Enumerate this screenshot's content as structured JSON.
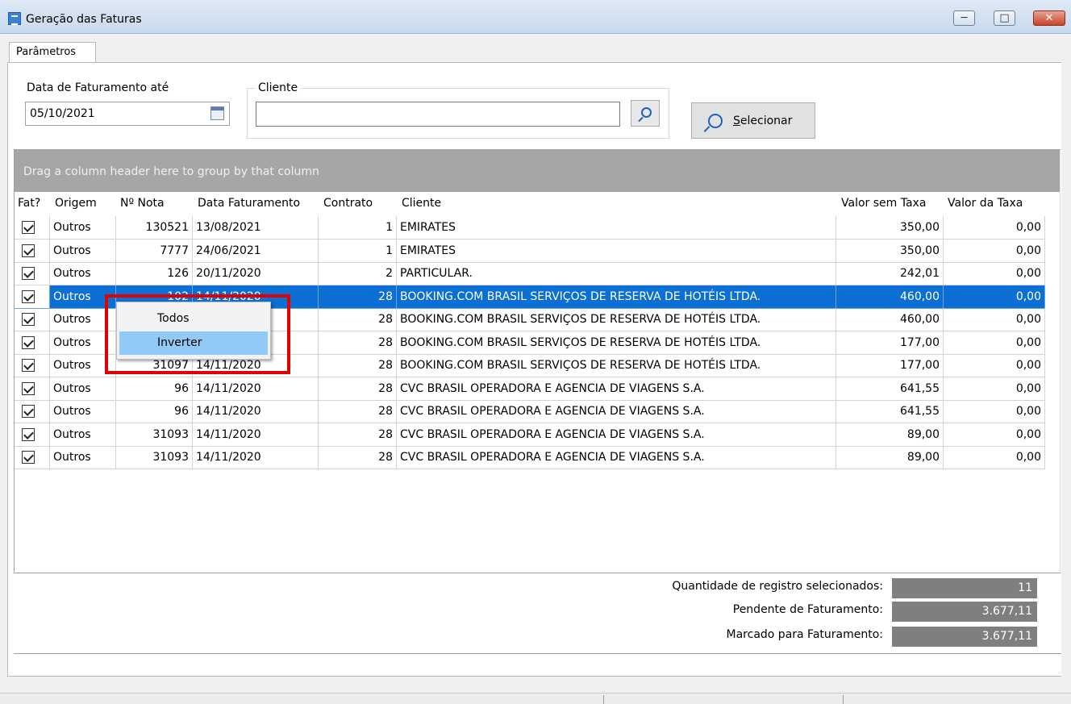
{
  "window": {
    "title": "Geração das Faturas",
    "min_glyph": "─",
    "max_glyph": "□",
    "close_glyph": "✕"
  },
  "tab": {
    "label": "Parâmetros"
  },
  "form": {
    "date_label": "Data de Faturamento até",
    "date_value": "05/10/2021",
    "client_legend": "Cliente",
    "client_value": "",
    "select_button_mnemonic": "S",
    "select_button_rest": "elecionar"
  },
  "grid": {
    "group_hint": "Drag a column header here to group by that column",
    "columns": [
      "Fat?",
      "Origem",
      "Nº Nota",
      "Data Faturamento",
      "Contrato",
      "Cliente",
      "Valor sem Taxa",
      "Valor da Taxa"
    ],
    "rows": [
      {
        "origem": "Outros",
        "nota": "130521",
        "data": "13/08/2021",
        "contrato": "1",
        "cliente": "EMIRATES",
        "valor": "350,00",
        "taxa": "0,00"
      },
      {
        "origem": "Outros",
        "nota": "7777",
        "data": "24/06/2021",
        "contrato": "1",
        "cliente": "EMIRATES",
        "valor": "350,00",
        "taxa": "0,00"
      },
      {
        "origem": "Outros",
        "nota": "126",
        "data": "20/11/2020",
        "contrato": "2",
        "cliente": "PARTICULAR.",
        "valor": "242,01",
        "taxa": "0,00"
      },
      {
        "origem": "Outros",
        "nota": "102",
        "data": "14/11/2020",
        "contrato": "28",
        "cliente": "BOOKING.COM BRASIL SERVIÇOS DE RESERVA DE HOTÉIS LTDA.",
        "valor": "460,00",
        "taxa": "0,00"
      },
      {
        "origem": "Outros",
        "nota": "",
        "data": "",
        "contrato": "28",
        "cliente": "BOOKING.COM BRASIL SERVIÇOS DE RESERVA DE HOTÉIS LTDA.",
        "valor": "460,00",
        "taxa": "0,00"
      },
      {
        "origem": "Outros",
        "nota": "",
        "data": "",
        "contrato": "28",
        "cliente": "BOOKING.COM BRASIL SERVIÇOS DE RESERVA DE HOTÉIS LTDA.",
        "valor": "177,00",
        "taxa": "0,00"
      },
      {
        "origem": "Outros",
        "nota": "31097",
        "data": "14/11/2020",
        "contrato": "28",
        "cliente": "BOOKING.COM BRASIL SERVIÇOS DE RESERVA DE HOTÉIS LTDA.",
        "valor": "177,00",
        "taxa": "0,00"
      },
      {
        "origem": "Outros",
        "nota": "96",
        "data": "14/11/2020",
        "contrato": "28",
        "cliente": "CVC BRASIL OPERADORA E AGENCIA DE VIAGENS S.A.",
        "valor": "641,55",
        "taxa": "0,00"
      },
      {
        "origem": "Outros",
        "nota": "96",
        "data": "14/11/2020",
        "contrato": "28",
        "cliente": "CVC BRASIL OPERADORA E AGENCIA DE VIAGENS S.A.",
        "valor": "641,55",
        "taxa": "0,00"
      },
      {
        "origem": "Outros",
        "nota": "31093",
        "data": "14/11/2020",
        "contrato": "28",
        "cliente": "CVC BRASIL OPERADORA E AGENCIA DE VIAGENS S.A.",
        "valor": "89,00",
        "taxa": "0,00"
      },
      {
        "origem": "Outros",
        "nota": "31093",
        "data": "14/11/2020",
        "contrato": "28",
        "cliente": "CVC BRASIL OPERADORA E AGENCIA DE VIAGENS S.A.",
        "valor": "89,00",
        "taxa": "0,00"
      }
    ],
    "selected_row": 4
  },
  "context_menu": {
    "items": [
      "Todos",
      "Inverter"
    ],
    "highlighted": "Inverter"
  },
  "summary": {
    "count_label": "Quantidade de registro selecionados:",
    "count_value": "11",
    "pending_label": "Pendente de Faturamento:",
    "pending_value": "3.677,11",
    "marked_label": "Marcado para Faturamento:",
    "marked_value": "3.677,11"
  },
  "colors": {
    "selection": "#0c6fd3",
    "menu_highlight": "#91c9f7",
    "annotation_frame": "#e00000"
  }
}
